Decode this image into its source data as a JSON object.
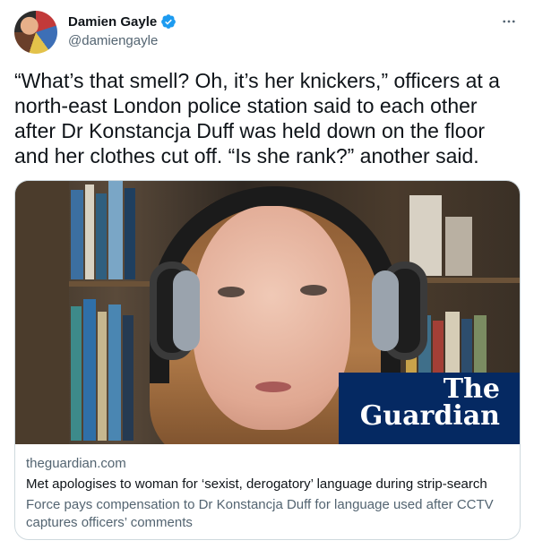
{
  "author": {
    "name": "Damien Gayle",
    "handle": "@damiengayle",
    "verified": true
  },
  "tweet": {
    "text": "“What’s that smell? Oh, it’s her knickers,” officers at a north-east London police station said to each other after Dr Konstancja Duff was held down on the floor and her clothes cut off. “Is she rank?” another said."
  },
  "card": {
    "brand_line1": "The",
    "brand_line2": "Guardian",
    "domain": "theguardian.com",
    "title": "Met apologises to woman for ‘sexist, derogatory’ language during strip-search",
    "description": "Force pays compensation to Dr Konstancja Duff for language used after CCTV captures officers’ comments"
  },
  "colors": {
    "verified_blue": "#1d9bf0",
    "guardian_navy": "#052962",
    "secondary_text": "#536471"
  },
  "icons": {
    "more": "more-horizontal-icon",
    "verified": "verified-badge-icon"
  }
}
